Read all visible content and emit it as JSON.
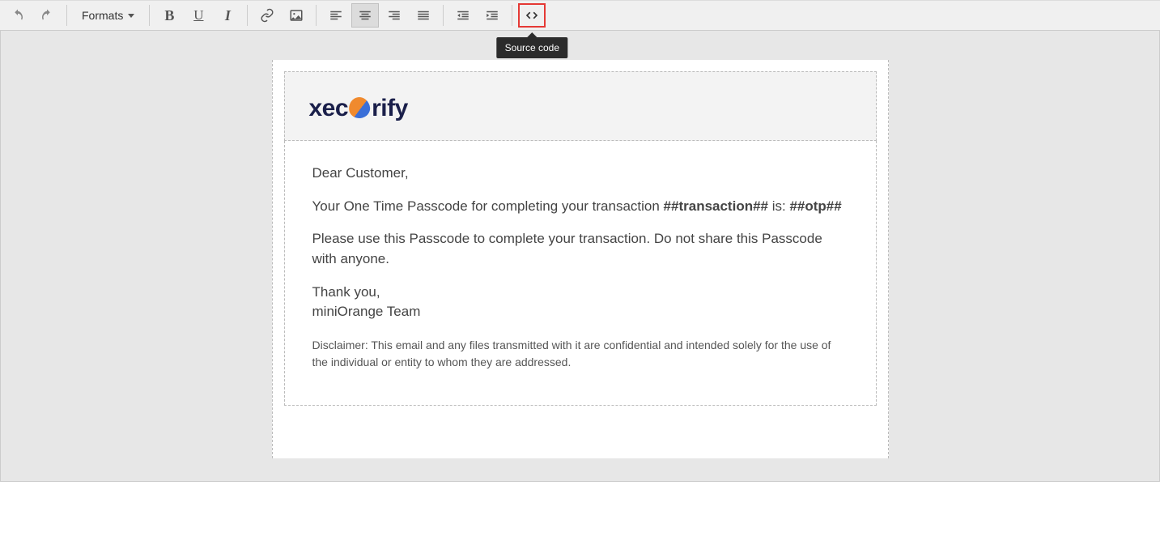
{
  "toolbar": {
    "formats_label": "Formats",
    "tooltip_source_code": "Source code"
  },
  "email": {
    "logo_text_1": "xec",
    "logo_text_2": "rify",
    "greeting": "Dear Customer,",
    "line1_pre": "Your One Time Passcode for completing your transaction ",
    "transaction_token": "##transaction##",
    "line1_mid": " is: ",
    "otp_token": "##otp##",
    "line2": "Please use this Passcode to complete your transaction. Do not share this Passcode with anyone.",
    "thanks_1": "Thank you,",
    "thanks_2": "miniOrange Team",
    "disclaimer": "Disclaimer: This email and any files transmitted with it are confidential and intended solely for the use of the individual or entity to whom they are addressed."
  }
}
